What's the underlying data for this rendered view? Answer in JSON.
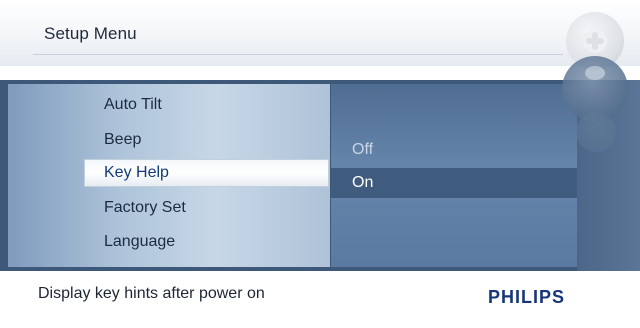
{
  "header": {
    "title": "Setup Menu"
  },
  "menu": {
    "items": [
      {
        "label": "Auto Tilt"
      },
      {
        "label": "Beep"
      },
      {
        "label": "Key Help"
      },
      {
        "label": "Factory Set"
      },
      {
        "label": "Language"
      }
    ],
    "selected_index": 2
  },
  "options": {
    "items": [
      {
        "label": "Off"
      },
      {
        "label": "On"
      }
    ],
    "selected_index": 1
  },
  "footer": {
    "hint": "Display key hints after power on",
    "brand": "PHILIPS"
  },
  "colors": {
    "band": "#3d5878",
    "selected_option_bg": "#3f5b7e",
    "brand": "#17357a"
  },
  "side_buttons": [
    "dpad-icon",
    "button-icon",
    "button-icon"
  ]
}
